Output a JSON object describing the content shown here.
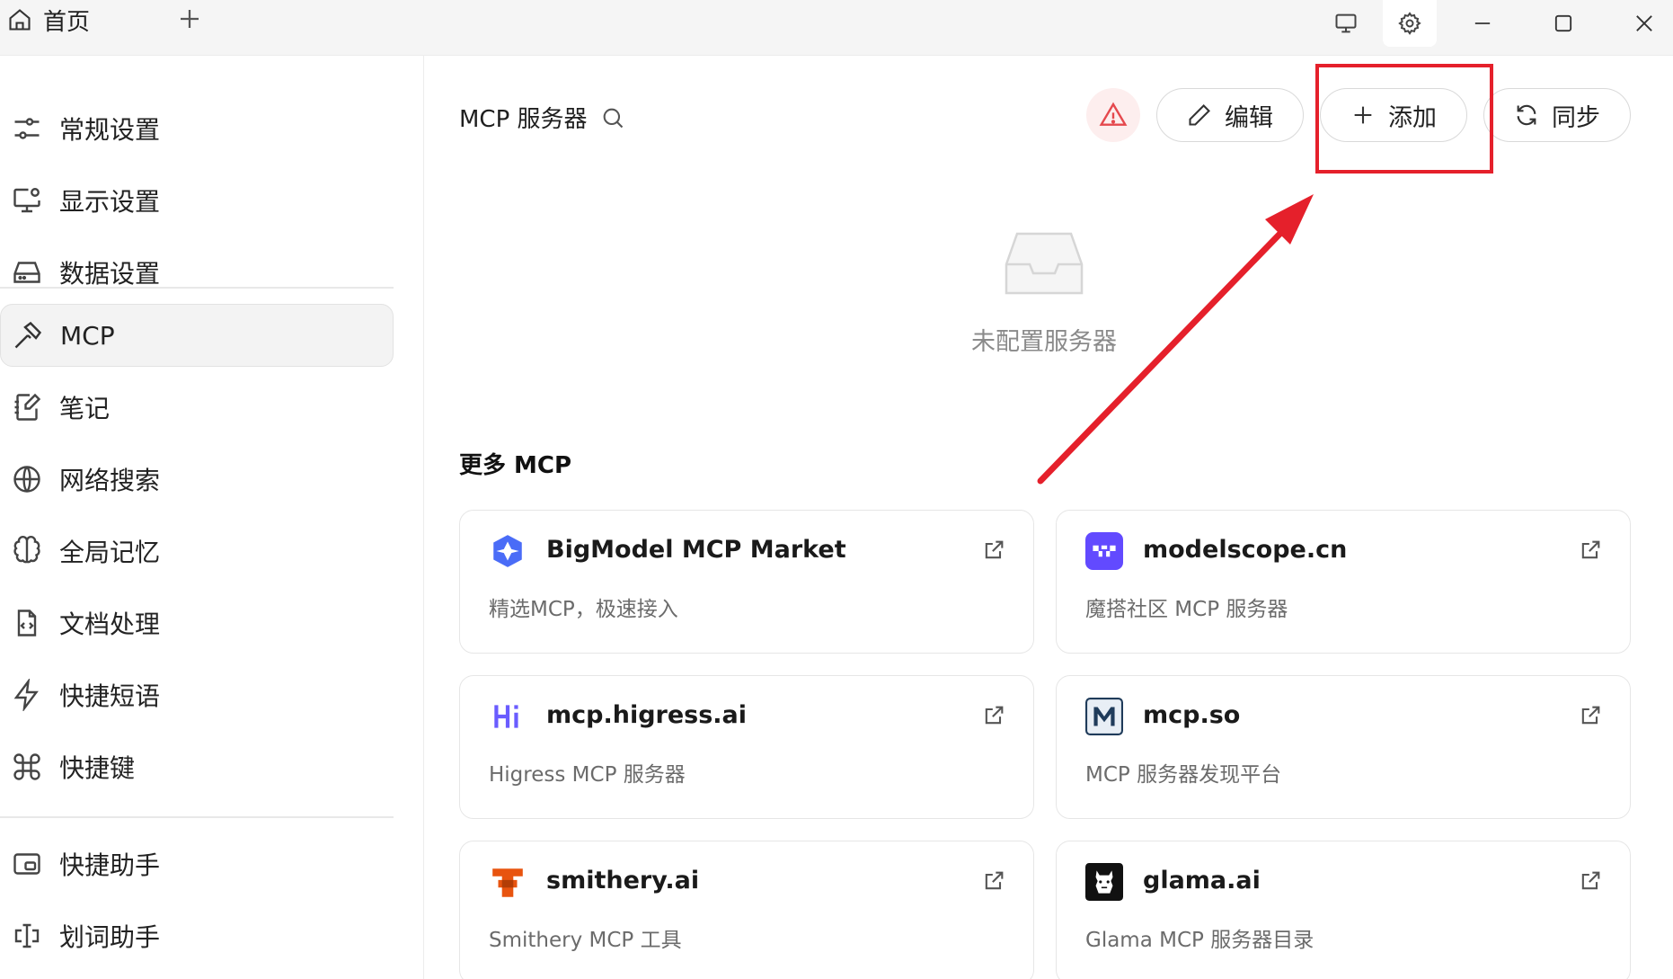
{
  "titlebar": {
    "home_label": "首页"
  },
  "sidebar": {
    "items": [
      {
        "label": "常规设置"
      },
      {
        "label": "显示设置"
      },
      {
        "label": "数据设置"
      },
      {
        "label": "MCP"
      },
      {
        "label": "笔记"
      },
      {
        "label": "网络搜索"
      },
      {
        "label": "全局记忆"
      },
      {
        "label": "文档处理"
      },
      {
        "label": "快捷短语"
      },
      {
        "label": "快捷键"
      },
      {
        "label": "快捷助手"
      },
      {
        "label": "划词助手"
      }
    ]
  },
  "main": {
    "title": "MCP 服务器",
    "buttons": {
      "edit": "编辑",
      "add": "添加",
      "sync": "同步"
    },
    "empty_text": "未配置服务器",
    "more_title": "更多 MCP",
    "cards": [
      {
        "name": "BigModel MCP Market",
        "desc": "精选MCP，极速接入"
      },
      {
        "name": "modelscope.cn",
        "desc": "魔搭社区 MCP 服务器"
      },
      {
        "name": "mcp.higress.ai",
        "desc": "Higress MCP 服务器"
      },
      {
        "name": "mcp.so",
        "desc": "MCP 服务器发现平台"
      },
      {
        "name": "smithery.ai",
        "desc": "Smithery MCP 工具"
      },
      {
        "name": "glama.ai",
        "desc": "Glama MCP 服务器目录"
      }
    ]
  },
  "colors": {
    "annotation_red": "#e5202b",
    "warning_red": "#e5484d"
  }
}
